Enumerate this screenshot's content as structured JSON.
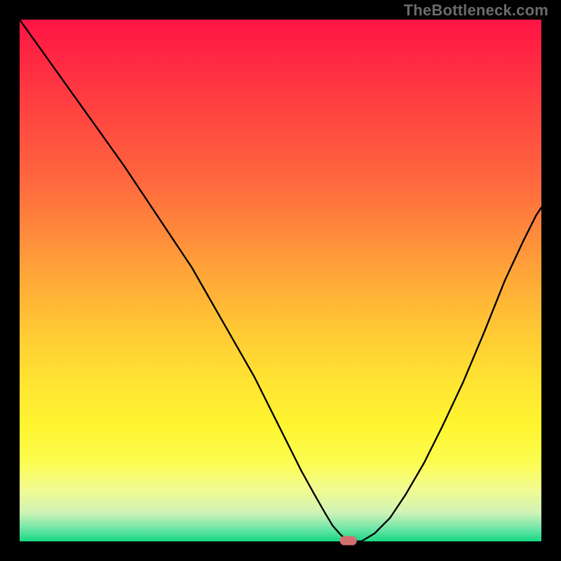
{
  "watermark": "TheBottleneck.com",
  "chart_data": {
    "type": "line",
    "title": "",
    "xlabel": "",
    "ylabel": "",
    "xlim": [
      0,
      100
    ],
    "ylim": [
      0,
      100
    ],
    "grid": false,
    "legend": false,
    "marker": {
      "x": 63,
      "y": 0,
      "color": "#d36f71",
      "shape": "rounded-rect"
    },
    "background_gradient": {
      "type": "vertical",
      "stops": [
        {
          "offset": 0.0,
          "color": "#ff1444"
        },
        {
          "offset": 0.1,
          "color": "#ff2f42"
        },
        {
          "offset": 0.2,
          "color": "#ff4a40"
        },
        {
          "offset": 0.3,
          "color": "#ff653e"
        },
        {
          "offset": 0.4,
          "color": "#ff873c"
        },
        {
          "offset": 0.5,
          "color": "#ffaa38"
        },
        {
          "offset": 0.6,
          "color": "#ffca34"
        },
        {
          "offset": 0.7,
          "color": "#ffe532"
        },
        {
          "offset": 0.78,
          "color": "#fff530"
        },
        {
          "offset": 0.85,
          "color": "#fcfd52"
        },
        {
          "offset": 0.9,
          "color": "#f2fb90"
        },
        {
          "offset": 0.945,
          "color": "#d0f3b6"
        },
        {
          "offset": 0.975,
          "color": "#70e6a8"
        },
        {
          "offset": 1.0,
          "color": "#18d884"
        }
      ]
    },
    "series": [
      {
        "name": "curve",
        "color": "#000000",
        "width": 2.4,
        "x": [
          0.0,
          5.0,
          10.0,
          15.0,
          20.0,
          25.0,
          30.0,
          33.0,
          37.0,
          41.0,
          45.0,
          48.0,
          51.0,
          54.0,
          56.5,
          58.5,
          60.0,
          61.5,
          63.0,
          65.5,
          68.0,
          71.0,
          74.0,
          77.5,
          81.0,
          85.0,
          89.0,
          93.0,
          96.5,
          99.0,
          100.0
        ],
        "y": [
          100.0,
          93.0,
          86.0,
          79.0,
          72.0,
          64.5,
          57.0,
          52.5,
          45.5,
          38.5,
          31.5,
          25.5,
          19.5,
          13.5,
          9.0,
          5.5,
          3.0,
          1.3,
          0.0,
          0.0,
          1.5,
          4.5,
          9.0,
          15.0,
          22.0,
          30.5,
          40.0,
          50.0,
          57.5,
          62.5,
          64.0
        ]
      }
    ]
  }
}
